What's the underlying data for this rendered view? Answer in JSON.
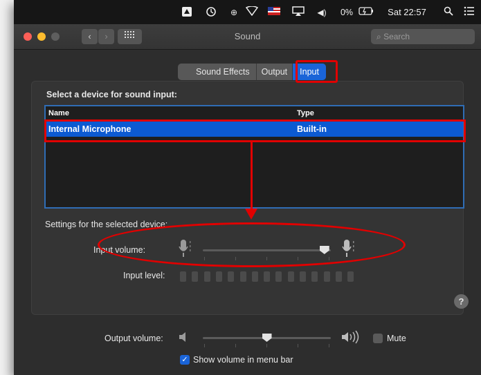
{
  "menubar": {
    "clock": "Sat 22:57",
    "battery": "0%",
    "icons": [
      "notification-icon",
      "time-machine-icon",
      "vpn-icon",
      "wifi-icon",
      "flag-icon",
      "airplay-icon",
      "volume-icon",
      "battery-icon",
      "spotlight-icon",
      "menu-icon"
    ]
  },
  "window": {
    "title": "Sound",
    "search_placeholder": "Search"
  },
  "tabs": [
    {
      "label": "Sound Effects",
      "active": false
    },
    {
      "label": "Output",
      "active": false
    },
    {
      "label": "Input",
      "active": true
    }
  ],
  "input": {
    "heading": "Select a device for sound input:",
    "columns": [
      "Name",
      "Type"
    ],
    "devices": [
      {
        "name": "Internal Microphone",
        "type": "Built-in",
        "selected": true
      }
    ],
    "settings_heading": "Settings for the selected device:",
    "input_volume_label": "Input volume:",
    "input_volume_value": 0.95,
    "input_level_label": "Input level:",
    "input_level_segments": 15,
    "input_level_active": 0
  },
  "output": {
    "volume_label": "Output volume:",
    "volume_value": 0.5,
    "mute_label": "Mute",
    "mute_checked": false,
    "show_volume_label": "Show volume in menu bar",
    "show_volume_checked": true
  },
  "colors": {
    "accent": "#1a64d8",
    "annotation": "#e10000",
    "window_bg": "#2d2d2d"
  }
}
